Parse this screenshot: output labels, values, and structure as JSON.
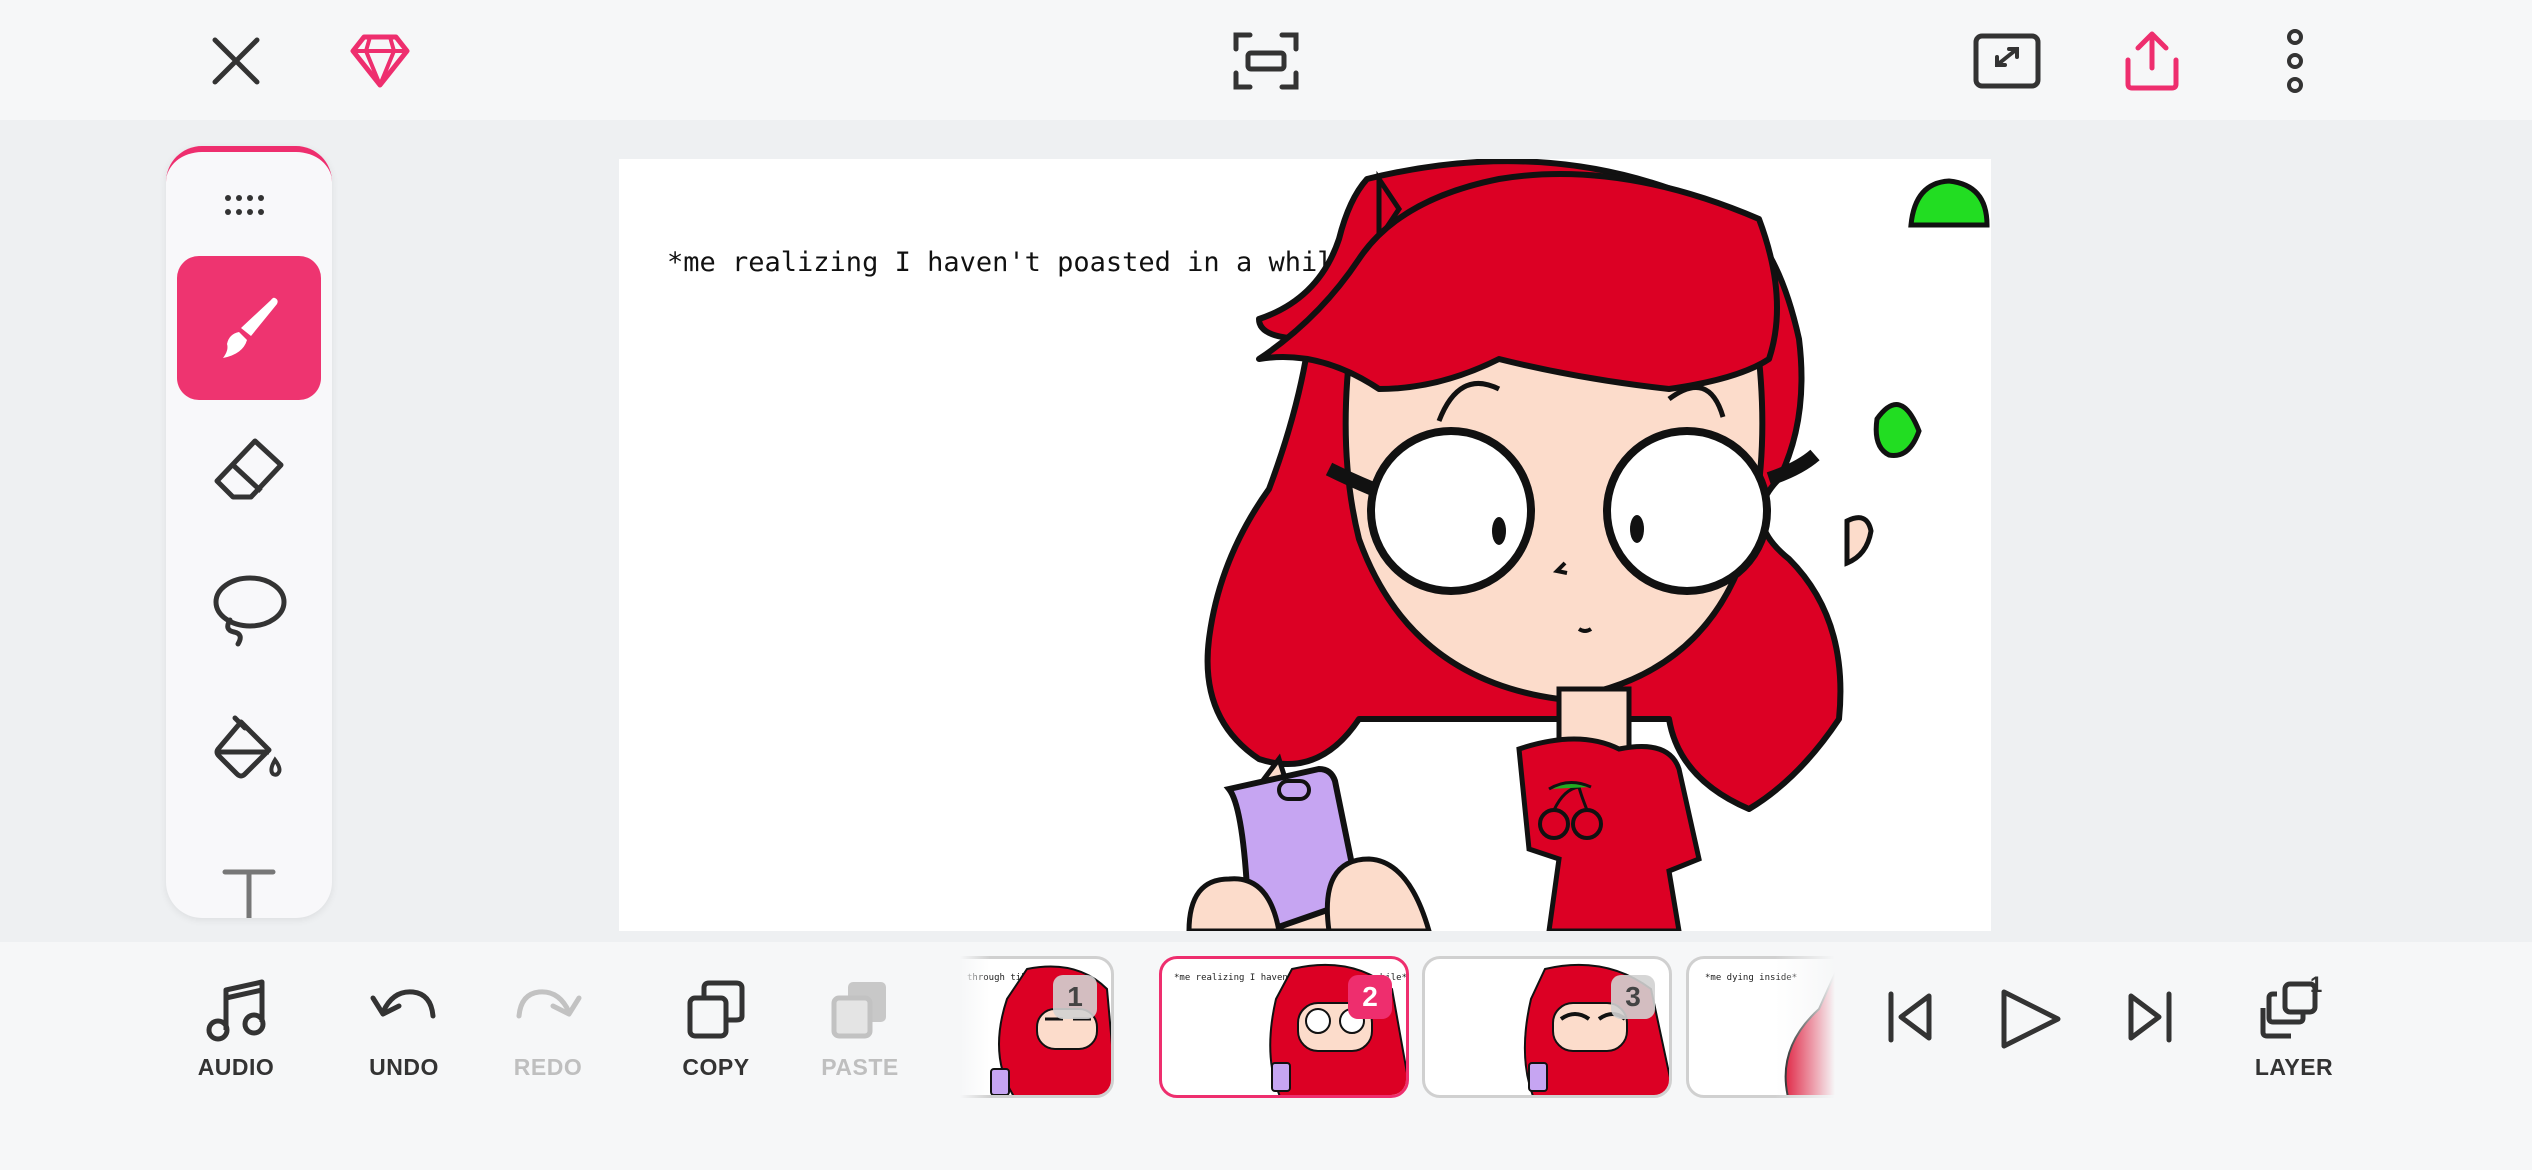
{
  "topbar": {
    "close_icon": "close-icon",
    "premium_icon": "diamond-icon",
    "fit_icon": "fit-screen-icon",
    "fullscreen_icon": "fullscreen-icon",
    "share_icon": "share-icon",
    "more_icon": "more-vertical-icon"
  },
  "tools": [
    {
      "name": "brush",
      "icon": "brush-icon",
      "active": true
    },
    {
      "name": "eraser",
      "icon": "eraser-icon",
      "active": false
    },
    {
      "name": "lasso",
      "icon": "lasso-icon",
      "active": false
    },
    {
      "name": "fill",
      "icon": "fill-bucket-icon",
      "active": false
    },
    {
      "name": "text",
      "icon": "text-icon",
      "active": false
    }
  ],
  "canvas": {
    "caption": "*me realizing I haven't poasted in a while*"
  },
  "bottombar": {
    "audio_label": "AUDIO",
    "undo_label": "UNDO",
    "redo_label": "REDO",
    "copy_label": "COPY",
    "paste_label": "PASTE",
    "layer_label": "LAYER",
    "layer_count": "1"
  },
  "frames": [
    {
      "number": "1",
      "caption": "through tiktok*"
    },
    {
      "number": "2",
      "caption": "*me realizing I haven't poasted in a while*"
    },
    {
      "number": "3",
      "caption": ""
    },
    {
      "number": "",
      "caption": "*me dying inside*"
    }
  ],
  "colors": {
    "accent": "#ee2e6e",
    "hair": "#dc0024",
    "skin": "#fcdccb",
    "phone": "#c6a5f2",
    "leaf": "#22dd22"
  }
}
